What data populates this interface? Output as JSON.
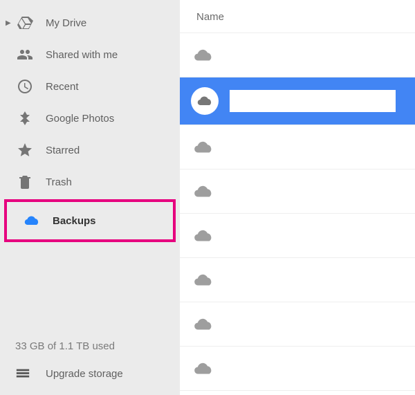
{
  "sidebar": {
    "items": {
      "my_drive": {
        "label": "My Drive"
      },
      "shared": {
        "label": "Shared with me"
      },
      "recent": {
        "label": "Recent"
      },
      "photos": {
        "label": "Google Photos"
      },
      "starred": {
        "label": "Starred"
      },
      "trash": {
        "label": "Trash"
      },
      "backups": {
        "label": "Backups"
      }
    },
    "storage_text": "33 GB of 1.1 TB used",
    "upgrade_label": "Upgrade storage"
  },
  "main": {
    "column_header": "Name",
    "rows": [
      {
        "selected": false
      },
      {
        "selected": true
      },
      {
        "selected": false
      },
      {
        "selected": false
      },
      {
        "selected": false
      },
      {
        "selected": false
      },
      {
        "selected": false
      },
      {
        "selected": false
      }
    ]
  },
  "colors": {
    "selected_row": "#4285f4",
    "highlight_border": "#e6007e",
    "icon_grey": "#757575",
    "icon_blue": "#2684fc"
  }
}
